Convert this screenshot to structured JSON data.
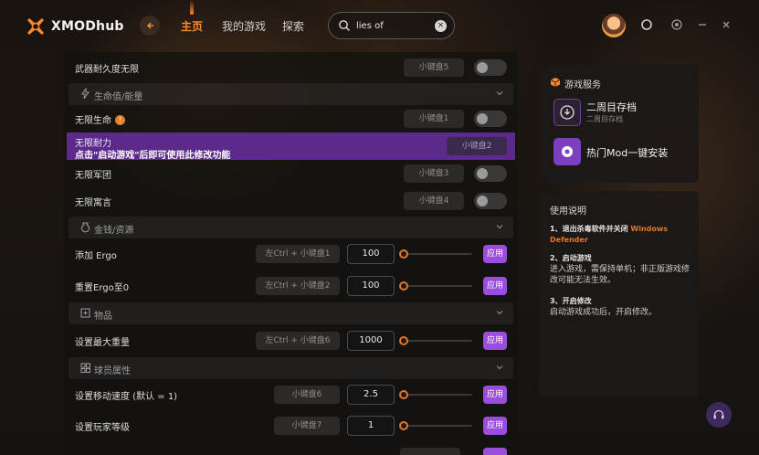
{
  "app": {
    "brand": "XMODhub"
  },
  "nav": {
    "items": [
      "主页",
      "我的游戏",
      "探索"
    ]
  },
  "search": {
    "value": "lies of"
  },
  "top_rows": [
    {
      "label": "武器耐久度无限",
      "key": "小键盘5"
    }
  ],
  "sections": {
    "vitals": "生命值/能量",
    "money": "金钱/资源",
    "items": "物品",
    "player": "球员属性"
  },
  "vitals_rows": {
    "infinite_life": {
      "label": "无限生命",
      "key": "小键盘1",
      "badge": "!"
    },
    "infinite_stamina": {
      "label": "无限耐力",
      "note": "点击\"启动游戏\"后即可使用此修改功能",
      "key": "小键盘2"
    },
    "infinite_legion": {
      "label": "无限军团",
      "key": "小键盘3"
    },
    "infinite_lies": {
      "label": "无限寓言",
      "key": "小键盘4"
    }
  },
  "money_rows": {
    "add_ergo": {
      "label": "添加 Ergo",
      "key": "左Ctrl + 小键盘1",
      "value": "100",
      "apply": "应用"
    },
    "reset_ergo": {
      "label": "重置Ergo至0",
      "key": "左Ctrl + 小键盘2",
      "value": "100",
      "apply": "应用"
    }
  },
  "item_rows": {
    "max_weight": {
      "label": "设置最大重量",
      "key": "左Ctrl + 小键盘6",
      "value": "1000",
      "apply": "应用"
    }
  },
  "player_rows": {
    "move_speed": {
      "label": "设置移动速度 (默认 = 1)",
      "key": "小键盘6",
      "value": "2.5",
      "apply": "应用"
    },
    "player_level": {
      "label": "设置玩家等级",
      "key": "小键盘7",
      "value": "1",
      "apply": "应用"
    }
  },
  "service": {
    "title": "游戏服务",
    "items": [
      {
        "title": "二周目存档",
        "subtitle": "二周目存档"
      },
      {
        "title": "热门Mod一键安装"
      }
    ]
  },
  "guide": {
    "title": "使用说明",
    "steps": [
      {
        "head": "1、退出杀毒软件并关闭",
        "warn": "Windows Defender",
        "body": ""
      },
      {
        "head": "2、启动游戏",
        "body": "进入游戏，需保持单机；非正版游戏修改可能无法生效。"
      },
      {
        "head": "3、开启修改",
        "body": "启动游戏成功后，开启修改。"
      }
    ]
  },
  "colors": {
    "accent": "#ff8a2a",
    "purple": "#9b4ddb",
    "highlight": "#5b2a8a"
  }
}
